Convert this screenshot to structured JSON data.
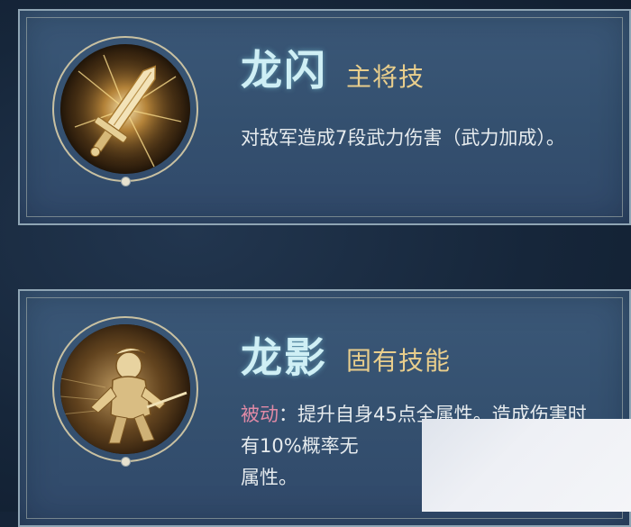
{
  "skills": [
    {
      "name": "龙闪",
      "type": "主将技",
      "icon": "sword-icon",
      "description": "对敌军造成7段武力伤害（武力加成）。"
    },
    {
      "name": "龙影",
      "type": "固有技能",
      "icon": "warrior-icon",
      "tag": "被动",
      "tag_separator": "：",
      "description": "提升自身45点全属性。造成伤害时有10%概率无",
      "description_tail": "属性。"
    }
  ],
  "colors": {
    "title": "#cfeff5",
    "type": "#e9ce8c",
    "passive_tag": "#e08aa6",
    "card": "#3b5878"
  }
}
